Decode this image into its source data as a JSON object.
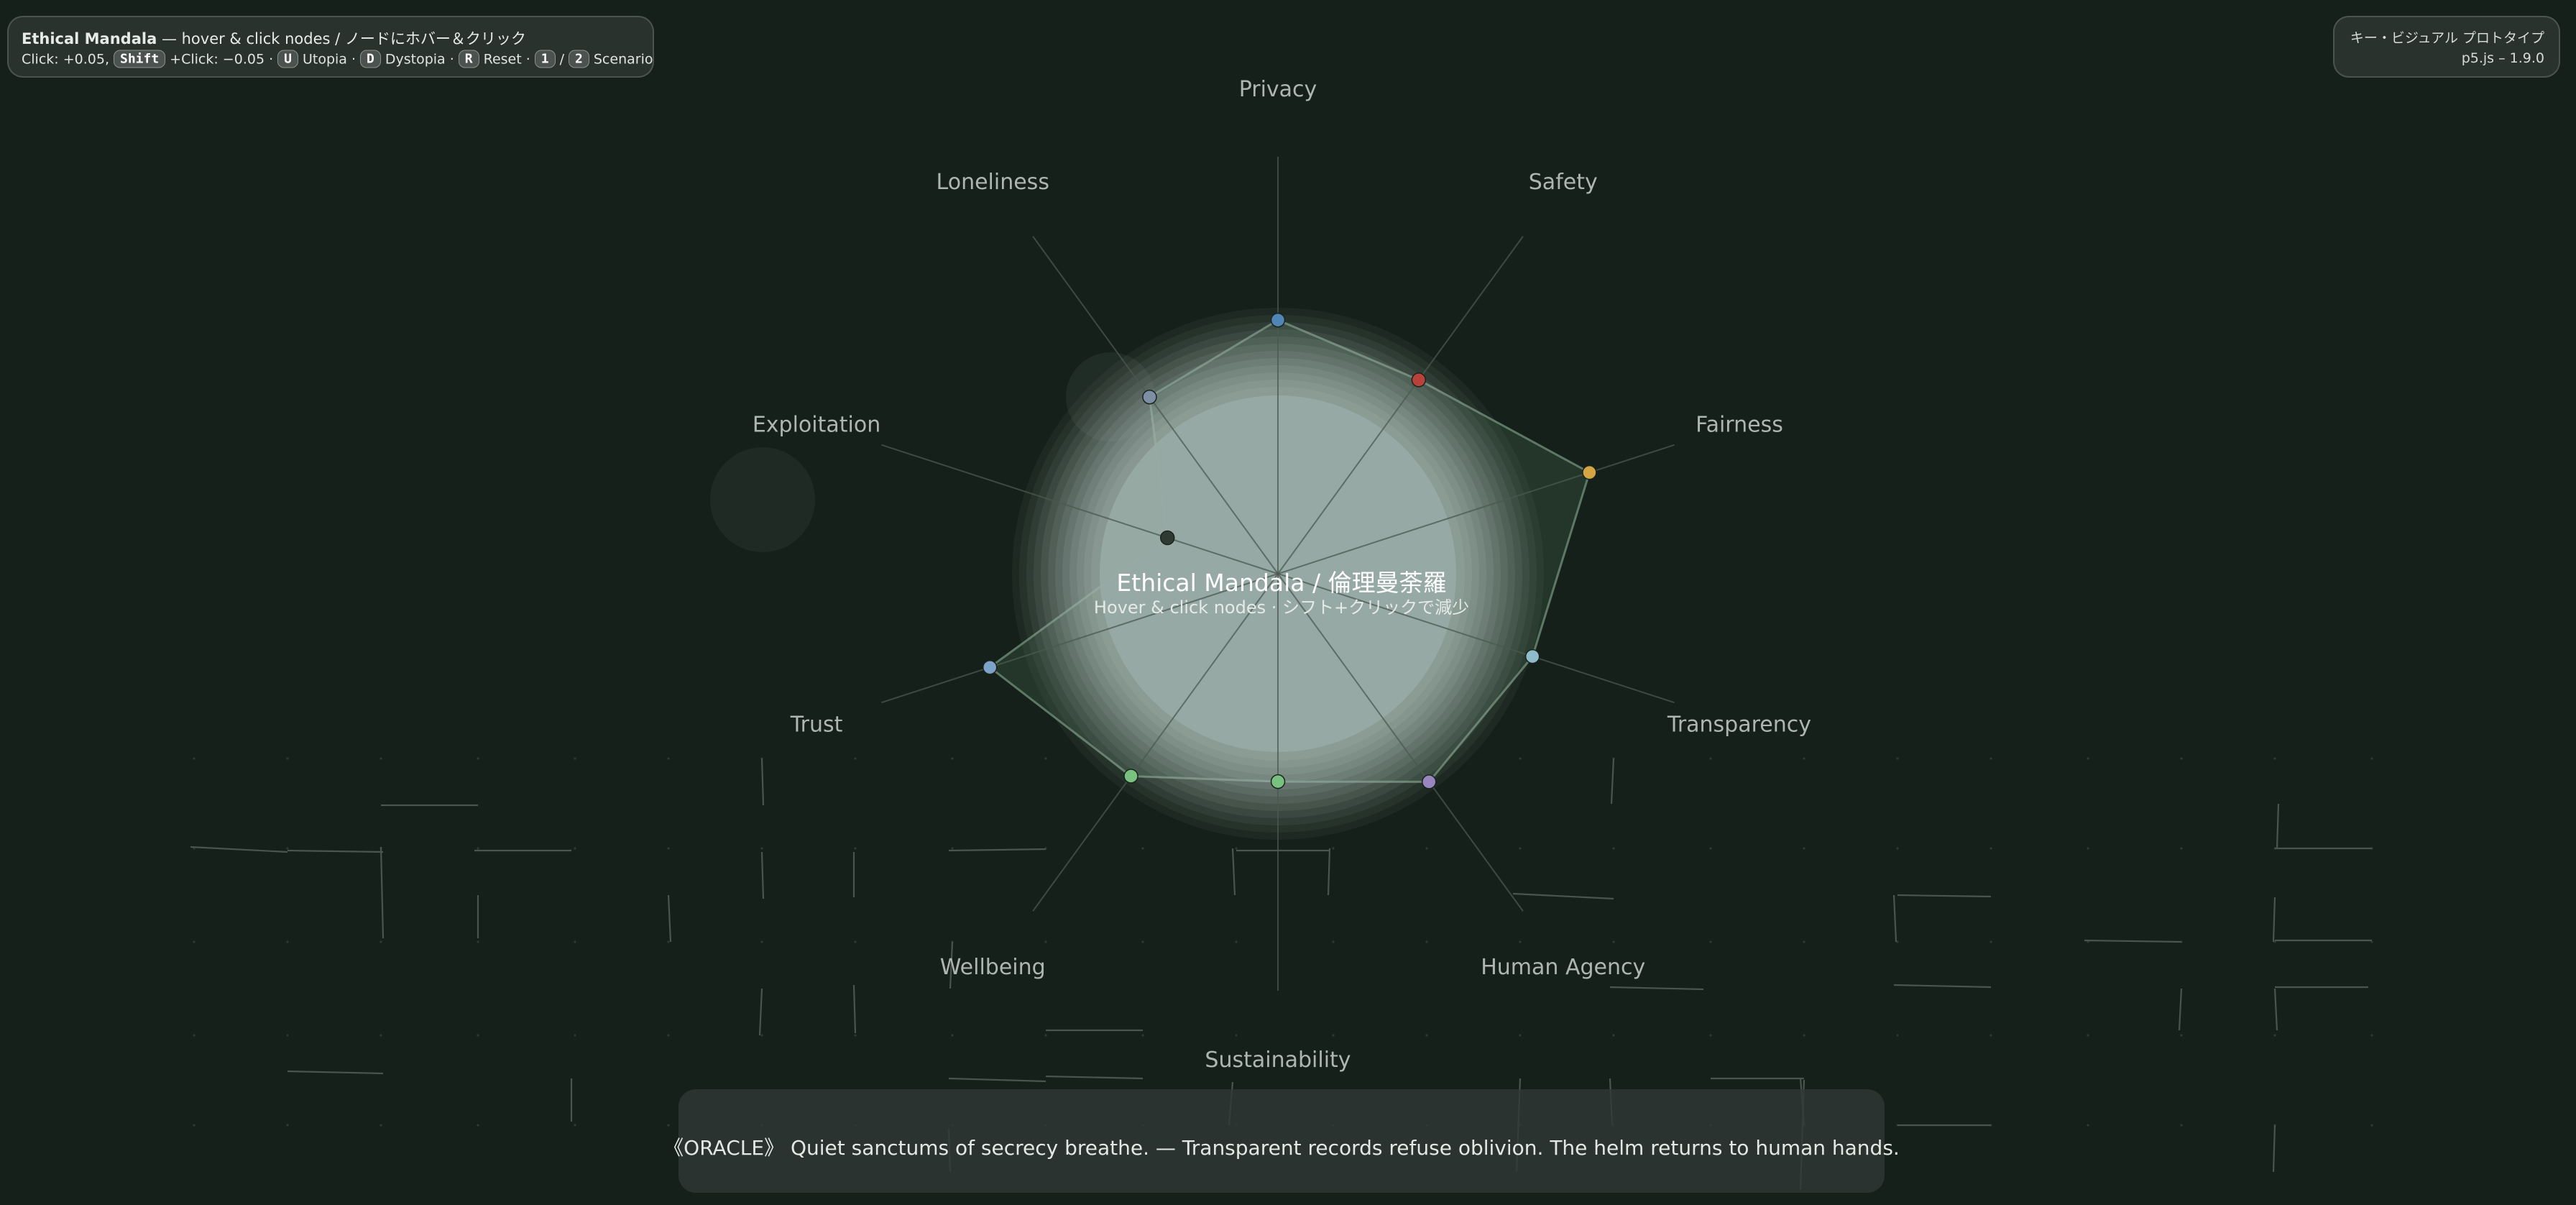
{
  "help": {
    "title_bold": "Ethical Mandala",
    "title_rest": " — hover & click nodes / ノードにホバー＆クリック",
    "click_text": "Click: +0.05,",
    "shift_key": "Shift",
    "shift_text": "+Click: −0.05 ·",
    "u_key": "U",
    "u_text": "Utopia ·",
    "d_key": "D",
    "d_text": "Dystopia ·",
    "r_key": "R",
    "r_text": "Reset ·",
    "one_key": "1",
    "slash": "/",
    "two_key": "2",
    "scenario_text": "Scenario"
  },
  "version_panel": {
    "prototype_label": "キー・ビジュアル プロトタイプ",
    "version_label": "p5.js – 1.9.0"
  },
  "center": {
    "title": "Ethical Mandala / 倫理曼荼羅",
    "subtitle": "Hover & click nodes · シフト+クリックで減少"
  },
  "oracle": {
    "text": "《ORACLE》 Quiet sanctums of secrecy breathe. — Transparent records refuse oblivion. The helm returns to human hands."
  },
  "mandala": {
    "values": [
      {
        "label": "Privacy",
        "value": 0.72,
        "color": "#4f86b5"
      },
      {
        "label": "Safety",
        "value": 0.68,
        "color": "#b8423a"
      },
      {
        "label": "Fairness",
        "value": 0.93,
        "color": "#d5a543"
      },
      {
        "label": "Transparency",
        "value": 0.76,
        "color": "#8fbccb"
      },
      {
        "label": "Human Agency",
        "value": 0.73,
        "color": "#9a86bf"
      },
      {
        "label": "Sustainability",
        "value": 0.59,
        "color": "#78c17e"
      },
      {
        "label": "Wellbeing",
        "value": 0.71,
        "color": "#78c17e"
      },
      {
        "label": "Trust",
        "value": 0.86,
        "color": "#7ea3c8"
      },
      {
        "label": "Exploitation",
        "value": 0.33,
        "color": "#2f3a33"
      },
      {
        "label": "Loneliness",
        "value": 0.62,
        "color": "#7e8ea4"
      }
    ]
  },
  "colors": {
    "background": "#15201a",
    "polygon_fill": "#26382c",
    "polygon_stroke": "#5d7865",
    "core": "#98aaa4",
    "label_text": "#aeb6b1",
    "spoke": "#4a5a50"
  }
}
